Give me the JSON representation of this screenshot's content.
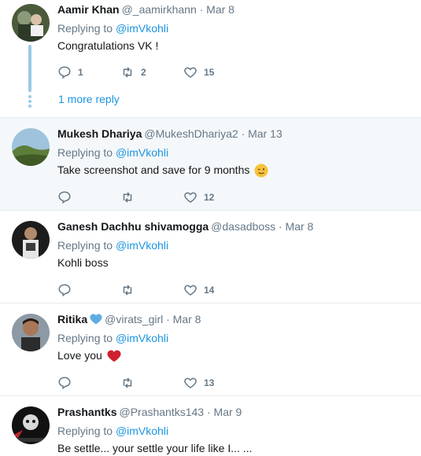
{
  "colors": {
    "accent": "#1b95e0",
    "muted": "#657786",
    "text": "#14171a",
    "highlight_bg": "#f5f8fa",
    "thread": "#9ac9e8"
  },
  "tweets": [
    {
      "name": "Aamir Khan",
      "meta": "@_aamirkhann · Mar 8",
      "replying_prefix": "Replying to ",
      "mention": "@imVkohli",
      "text": "Congratulations VK !",
      "reply_count": "1",
      "retweet_count": "2",
      "like_count": "15",
      "more_reply": "1 more reply"
    },
    {
      "name": "Mukesh Dhariya",
      "meta": "@MukeshDhariya2 · Mar 13",
      "replying_prefix": "Replying to ",
      "mention": "@imVkohli",
      "text": "Take screenshot and save for 9 months",
      "reply_count": "",
      "retweet_count": "",
      "like_count": "12"
    },
    {
      "name": "Ganesh Dachhu shivamogga",
      "meta": "@dasadboss · Mar 8",
      "replying_prefix": "Replying to ",
      "mention": "@imVkohli",
      "text": "Kohli boss",
      "reply_count": "",
      "retweet_count": "",
      "like_count": "14"
    },
    {
      "name": "Ritika",
      "meta": "@virats_girl · Mar 8",
      "replying_prefix": "Replying to ",
      "mention": "@imVkohli",
      "text": "Love you",
      "reply_count": "",
      "retweet_count": "",
      "like_count": "13"
    },
    {
      "name": "Prashantks",
      "meta": "@Prashantks143 · Mar 9",
      "replying_prefix": "Replying to ",
      "mention": "@imVkohli",
      "text": "Be settle... your settle your life like I... ..."
    }
  ]
}
